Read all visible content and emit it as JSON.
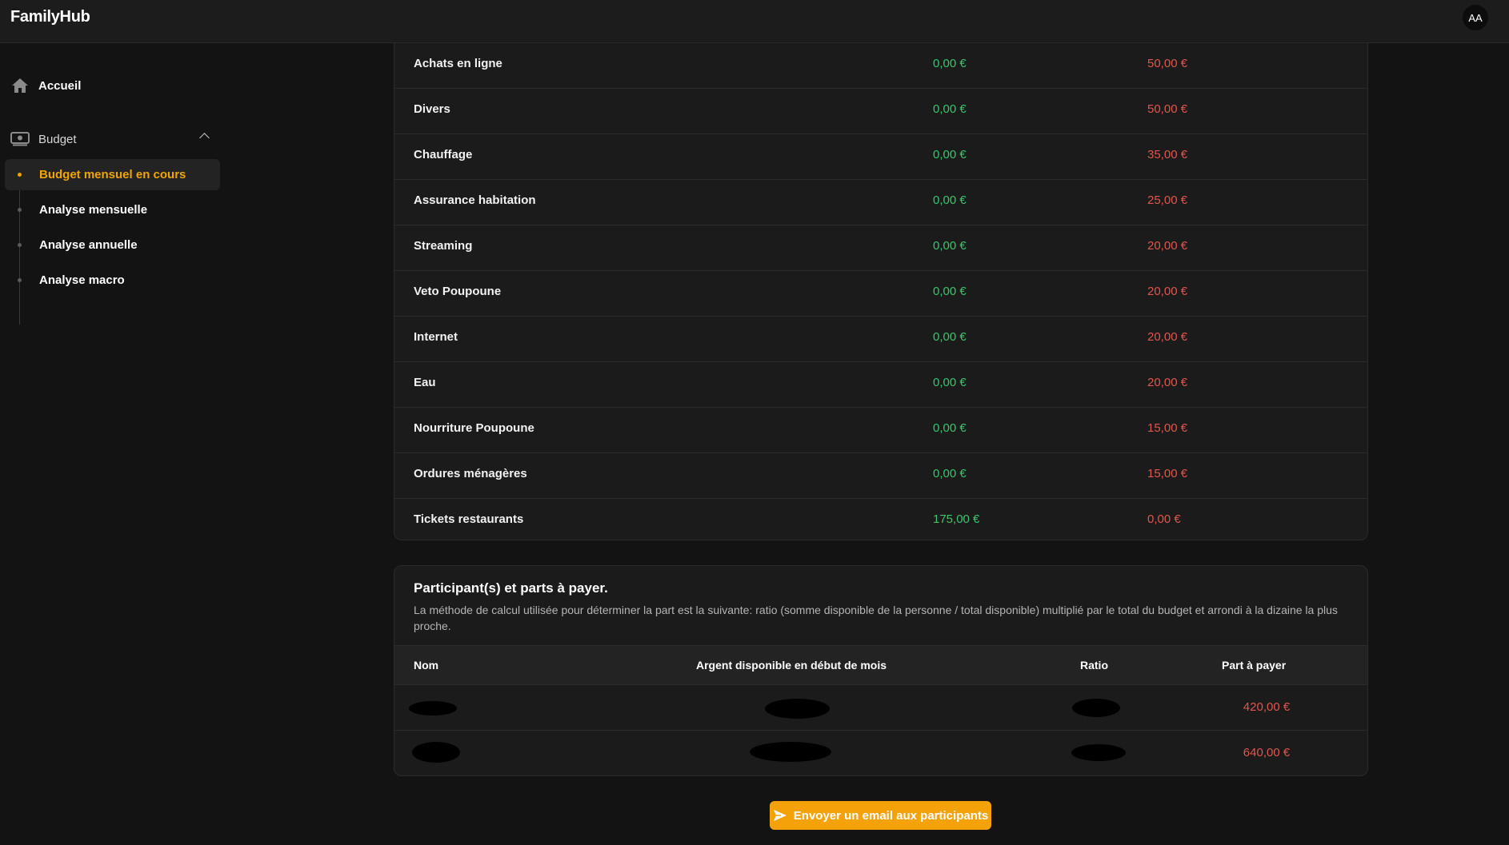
{
  "app": {
    "brand": "FamilyHub",
    "avatar_initials": "AA"
  },
  "sidebar": {
    "home": {
      "label": "Accueil",
      "icon": "home-icon"
    },
    "budget": {
      "label": "Budget",
      "icon": "money-icon",
      "expanded": true
    },
    "items": [
      {
        "label": "Budget mensuel en cours",
        "active": true
      },
      {
        "label": "Analyse mensuelle",
        "active": false
      },
      {
        "label": "Analyse annuelle",
        "active": false
      },
      {
        "label": "Analyse macro",
        "active": false
      }
    ]
  },
  "budget_rows": [
    {
      "name": "Achats en ligne",
      "v1": "0,00 €",
      "v2": "50,00 €"
    },
    {
      "name": "Divers",
      "v1": "0,00 €",
      "v2": "50,00 €"
    },
    {
      "name": "Chauffage",
      "v1": "0,00 €",
      "v2": "35,00 €"
    },
    {
      "name": "Assurance habitation",
      "v1": "0,00 €",
      "v2": "25,00 €"
    },
    {
      "name": "Streaming",
      "v1": "0,00 €",
      "v2": "20,00 €"
    },
    {
      "name": "Veto Poupoune",
      "v1": "0,00 €",
      "v2": "20,00 €"
    },
    {
      "name": "Internet",
      "v1": "0,00 €",
      "v2": "20,00 €"
    },
    {
      "name": "Eau",
      "v1": "0,00 €",
      "v2": "20,00 €"
    },
    {
      "name": "Nourriture Poupoune",
      "v1": "0,00 €",
      "v2": "15,00 €"
    },
    {
      "name": "Ordures ménagères",
      "v1": "0,00 €",
      "v2": "15,00 €"
    },
    {
      "name": "Tickets restaurants",
      "v1": "175,00 €",
      "v2": "0,00 €"
    }
  ],
  "participants": {
    "title": "Participant(s) et parts à payer.",
    "description": "La méthode de calcul utilisée pour déterminer la part est la suivante: ratio (somme disponible de la personne / total disponible) multiplié par le total du budget et arrondi à la dizaine la plus proche.",
    "headers": {
      "name": "Nom",
      "available": "Argent disponible en début de mois",
      "ratio": "Ratio",
      "share": "Part à payer"
    },
    "rows": [
      {
        "share": "420,00 €"
      },
      {
        "share": "640,00 €"
      }
    ]
  },
  "send_button": {
    "label": "Envoyer un email aux participants",
    "icon": "send-icon"
  },
  "colors": {
    "accent": "#f0a500",
    "positive": "#3ec46d",
    "negative": "#e0574f",
    "button": "#f5a20a"
  }
}
